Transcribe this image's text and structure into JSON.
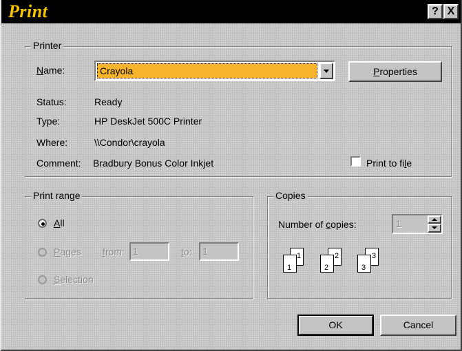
{
  "window": {
    "title": "Print",
    "help_label": "?",
    "close_label": "X"
  },
  "printer": {
    "group_label": "Printer",
    "name_label": "Name:",
    "name_value": "Crayola",
    "properties_label": "Properties",
    "status_label": "Status:",
    "status_value": "Ready",
    "type_label": "Type:",
    "type_value": "HP DeskJet 500C Printer",
    "where_label": "Where:",
    "where_value": "\\\\Condor\\crayola",
    "comment_label": "Comment:",
    "comment_value": "Bradbury Bonus Color Inkjet",
    "print_to_file_label": "Print to file",
    "print_to_file_checked": false
  },
  "print_range": {
    "group_label": "Print range",
    "all_label": "All",
    "all_selected": true,
    "pages_label": "Pages",
    "from_label": "from:",
    "from_value": "1",
    "to_label": "to:",
    "to_value": "1",
    "selection_label": "Selection"
  },
  "copies": {
    "group_label": "Copies",
    "number_label": "Number of copies:",
    "number_value": "1",
    "collate_pages": [
      "1",
      "1",
      "2",
      "2",
      "3",
      "3"
    ]
  },
  "buttons": {
    "ok_label": "OK",
    "cancel_label": "Cancel"
  },
  "colors": {
    "face": "#c4c4c4",
    "title_bg": "#000000",
    "title_text": "#f4c400",
    "highlight": "#f7b42c"
  }
}
